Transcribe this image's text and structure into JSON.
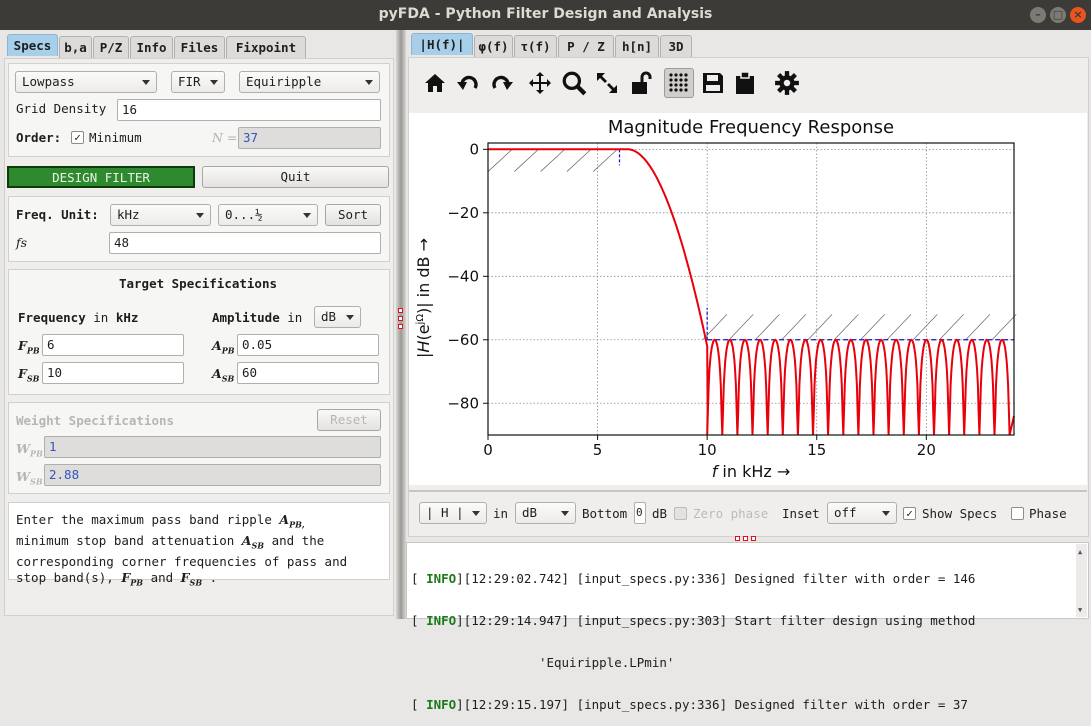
{
  "window": {
    "title": "pyFDA - Python Filter Design and Analysis",
    "controls": [
      "–",
      "□",
      "×"
    ]
  },
  "left_tabs": [
    "Specs",
    "b,a",
    "P/Z",
    "Info",
    "Files",
    "Fixpoint"
  ],
  "filter": {
    "response_type": "Lowpass",
    "filter_type": "FIR",
    "design_method": "Equiripple",
    "grid_density_label": "Grid Density",
    "grid_density": "16",
    "order_label": "Order:",
    "minimum_label": "Minimum",
    "n_label": "N =",
    "n_value": "37"
  },
  "buttons": {
    "design": "DESIGN FILTER",
    "quit": "Quit",
    "sort": "Sort",
    "reset": "Reset"
  },
  "freq": {
    "unit_label": "Freq. Unit:",
    "unit": "kHz",
    "range": "0...½",
    "fs_label": "fs",
    "fs_value": "48"
  },
  "target": {
    "title": "Target Specifications",
    "freq_label_a": "Frequency",
    "freq_label_b": "in",
    "freq_label_c": "kHz",
    "amp_label_a": "Amplitude",
    "amp_label_b": "in",
    "amp_unit": "dB",
    "fpb_label": "F",
    "fpb_sub": "PB",
    "fpb": "6",
    "fsb_label": "F",
    "fsb_sub": "SB",
    "fsb": "10",
    "apb_label": "A",
    "apb_sub": "PB",
    "apb": "0.05",
    "asb_label": "A",
    "asb_sub": "SB",
    "asb": "60"
  },
  "weight": {
    "title": "Weight Specifications",
    "wpb_label": "W",
    "wpb_sub": "PB",
    "wpb": "1",
    "wsb_label": "W",
    "wsb_sub": "SB",
    "wsb": "2.88"
  },
  "help": {
    "line1": "Enter the maximum pass band ripple",
    "line1b": "A",
    "line1s": "PB,",
    "line2": "minimum stop band attenuation",
    "line2b": "A",
    "line2s": "SB",
    "line2c": "and the",
    "line3": "corresponding corner frequencies of pass and",
    "line4": "stop band(s),",
    "l4b": "F",
    "l4s": "PB",
    "l4and": "and",
    "l4c": "F",
    "l4cs": "SB",
    "l4end": "."
  },
  "right_tabs": [
    "|H(f)|",
    "φ(f)",
    "τ(f)",
    "P / Z",
    "h[n]",
    "3D"
  ],
  "toolbar": [
    "home-icon",
    "undo-icon",
    "redo-icon",
    "pan-icon",
    "zoom-icon",
    "fullscreen-icon",
    "lock-icon",
    "grid-icon",
    "save-icon",
    "clipboard-icon",
    "gear-icon"
  ],
  "plot_controls": {
    "response": "| H |",
    "in_label": "in",
    "unit": "dB",
    "bottom_label": "Bottom",
    "bottom_value": "0",
    "bottom_unit": "dB",
    "zero_phase": "Zero phase",
    "inset_label": "Inset",
    "inset": "off",
    "show_specs": "Show Specs",
    "phase": "Phase"
  },
  "log": [
    {
      "tag": "INFO",
      "text": "[12:29:02.742] [input_specs.py:336] Designed filter with order = 146"
    },
    {
      "tag": "INFO",
      "text": "[12:29:14.947] [input_specs.py:303] Start filter design using method"
    },
    {
      "tag": "",
      "text": "         'Equiripple.LPmin'"
    },
    {
      "tag": "INFO",
      "text": "[12:29:15.197] [input_specs.py:336] Designed filter with order = 37"
    }
  ],
  "chart_data": {
    "type": "line",
    "title": "Magnitude Frequency Response",
    "xlabel": "f in kHz →",
    "ylabel": "|H(e^jΩ)| in dB →",
    "xlim": [
      0,
      24
    ],
    "ylim": [
      -90,
      2
    ],
    "xticks": [
      0,
      5,
      10,
      15,
      20
    ],
    "yticks": [
      0,
      -20,
      -40,
      -60,
      -80
    ],
    "grid": true,
    "passband_edge": 6,
    "stopband_edge": 10,
    "stopband_level": -60,
    "series": [
      {
        "color": "#e8000b",
        "x": [
          0,
          6,
          10,
          24
        ],
        "y": [
          0,
          0,
          -60,
          -60
        ]
      }
    ],
    "spec_color": "#1010d0"
  }
}
